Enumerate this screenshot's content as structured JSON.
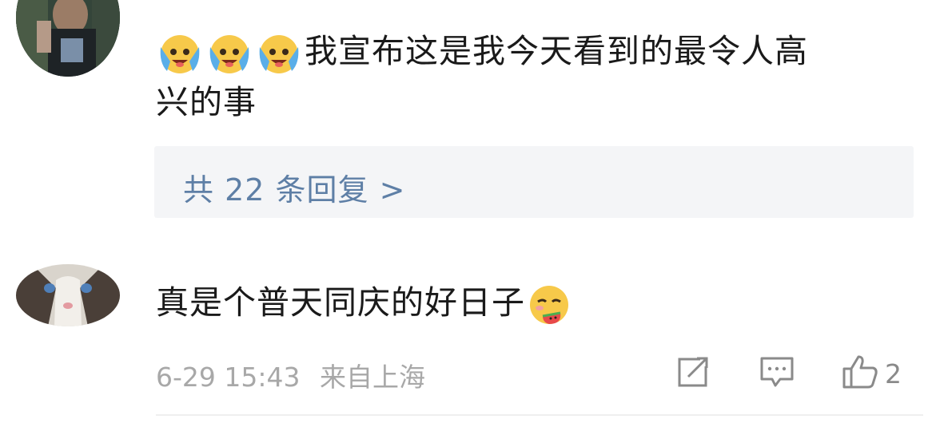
{
  "comments": [
    {
      "text_line1": "我宣布这是我今天看到的最令人高",
      "text_line2": "兴的事",
      "leading_emojis": [
        "crying-happy-emoji",
        "crying-happy-emoji",
        "crying-happy-emoji"
      ],
      "replies_label": "共 22 条回复 >"
    },
    {
      "text": "真是个普天同庆的好日子",
      "trailing_emoji": "eating-watermelon-emoji",
      "timestamp": "6-29 15:43",
      "location": "来自上海",
      "like_count": "2"
    }
  ],
  "icons": {
    "share": "share-icon",
    "comment": "comment-icon",
    "like": "thumbs-up-icon"
  },
  "colors": {
    "link": "#5e7fa6",
    "meta": "#a8a8a8",
    "reply_bg": "#f4f5f7"
  }
}
